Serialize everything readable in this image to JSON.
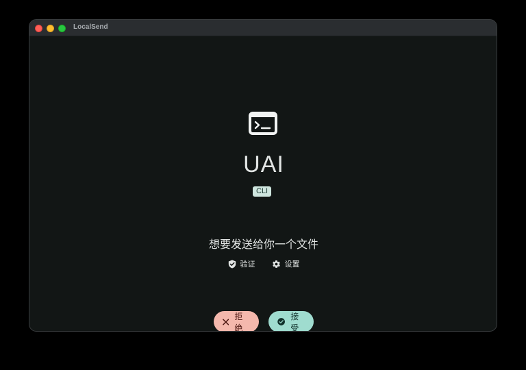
{
  "window": {
    "title": "LocalSend"
  },
  "sender": {
    "icon": "terminal-icon",
    "name": "UAI",
    "badge": "CLI"
  },
  "message": "想要发送给你一个文件",
  "links": {
    "verify_label": "验证",
    "verify_icon": "shield-check-icon",
    "settings_label": "设置",
    "settings_icon": "gear-icon"
  },
  "actions": {
    "decline_label": "拒绝",
    "decline_icon": "close-icon",
    "accept_label": "接受",
    "accept_icon": "check-circle-icon"
  },
  "colors": {
    "background": "#121615",
    "decline": "#f4b8ad",
    "accept": "#9fdccf",
    "badge": "#cfe6df"
  }
}
